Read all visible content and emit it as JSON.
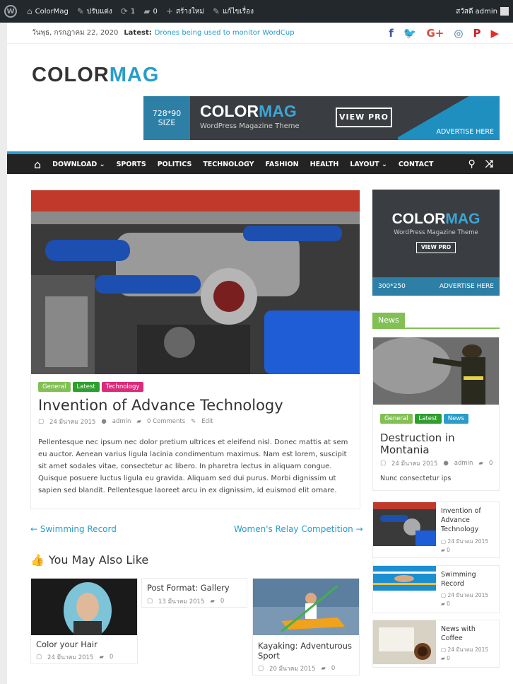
{
  "adminbar": {
    "site": "ColorMag",
    "customize": "ปรับแต่ง",
    "updates": "1",
    "comments": "0",
    "new": "สร้างใหม่",
    "edit": "แก้ไขเรื่อง",
    "greeting": "สวัสดี admin"
  },
  "topbar": {
    "date": "วันพุธ, กรกฎาคม 22, 2020",
    "latest_label": "Latest:",
    "latest_link": "Drones being used to monitor WordCup",
    "social": [
      {
        "icon": "facebook-icon",
        "glyph": "f",
        "color": "#3b5998"
      },
      {
        "icon": "twitter-icon",
        "glyph": "🐦",
        "color": "#1da1f2"
      },
      {
        "icon": "google-plus-icon",
        "glyph": "G+",
        "color": "#dd4b39"
      },
      {
        "icon": "instagram-icon",
        "glyph": "◎",
        "color": "#3f729b"
      },
      {
        "icon": "pinterest-icon",
        "glyph": "P",
        "color": "#cb2027"
      },
      {
        "icon": "youtube-icon",
        "glyph": "▶",
        "color": "#e52d27"
      }
    ]
  },
  "logo": {
    "color_part": "COLOR",
    "mag_part": "MAG"
  },
  "banner": {
    "size": "728*90 SIZE",
    "brand_color": "COLOR",
    "brand_mag": "MAG",
    "tagline": "WordPress Magazine Theme",
    "view_pro": "VIEW PRO",
    "advertise": "ADVERTISE HERE"
  },
  "nav": {
    "items": [
      "DOWNLOAD ⌄",
      "SPORTS",
      "POLITICS",
      "TECHNOLOGY",
      "FASHION",
      "HEALTH",
      "LAYOUT ⌄",
      "CONTACT"
    ],
    "accent": "#289dcc"
  },
  "post": {
    "categories": [
      {
        "label": "General",
        "color": "#82c055"
      },
      {
        "label": "Latest",
        "color": "#2e9e2e"
      },
      {
        "label": "Technology",
        "color": "#dd2a7b"
      }
    ],
    "title": "Invention of Advance Technology",
    "date": "24 มีนาคม 2015",
    "author": "admin",
    "comments": "0 Comments",
    "edit": "Edit",
    "body": "Pellentesque nec ipsum nec dolor pretium ultrices et eleifend nisl. Donec mattis at sem eu auctor. Aenean varius ligula lacinia condimentum maximus. Nam est lorem, suscipit sit amet sodales vitae, consectetur ac libero. In pharetra lectus in aliquam congue. Quisque posuere luctus ligula eu gravida. Aliquam sed dui purus. Morbi dignissim ut sapien sed blandit. Pellentesque laoreet arcu in ex dignissim, id euismod elit ornare."
  },
  "postnav": {
    "prev": "← Swimming Record",
    "next": "Women's Relay Competition →"
  },
  "related": {
    "heading": "You May Also Like",
    "items": [
      {
        "title": "Color your Hair",
        "date": "24 มีนาคม 2015",
        "comments": "0"
      },
      {
        "title": "Post Format: Gallery",
        "date": "13 มีนาคม 2015",
        "comments": "0"
      },
      {
        "title": "Kayaking: Adventurous Sport",
        "date": "20 มีนาคม 2015",
        "comments": "0"
      }
    ]
  },
  "sidebar": {
    "ad": {
      "brand_color": "COLOR",
      "brand_mag": "MAG",
      "tagline": "WordPress Magazine Theme",
      "view_pro": "VIEW PRO",
      "size": "300*250",
      "advertise": "ADVERTISE HERE"
    },
    "news_heading": "News",
    "featured": {
      "categories": [
        {
          "label": "General",
          "color": "#82c055"
        },
        {
          "label": "Latest",
          "color": "#2e9e2e"
        },
        {
          "label": "News",
          "color": "#289dcc"
        }
      ],
      "title": "Destruction in Montania",
      "date": "24 มีนาคม 2015",
      "author": "admin",
      "comments": "0",
      "excerpt": "Nunc consectetur ips"
    },
    "list": [
      {
        "title": "Invention of Advance Technology",
        "date": "24 มีนาคม 2015",
        "comments": "0"
      },
      {
        "title": "Swimming Record",
        "date": "24 มีนาคม 2015",
        "comments": "0"
      },
      {
        "title": "News with Coffee",
        "date": "24 มีนาคม 2015",
        "comments": "0"
      }
    ]
  }
}
